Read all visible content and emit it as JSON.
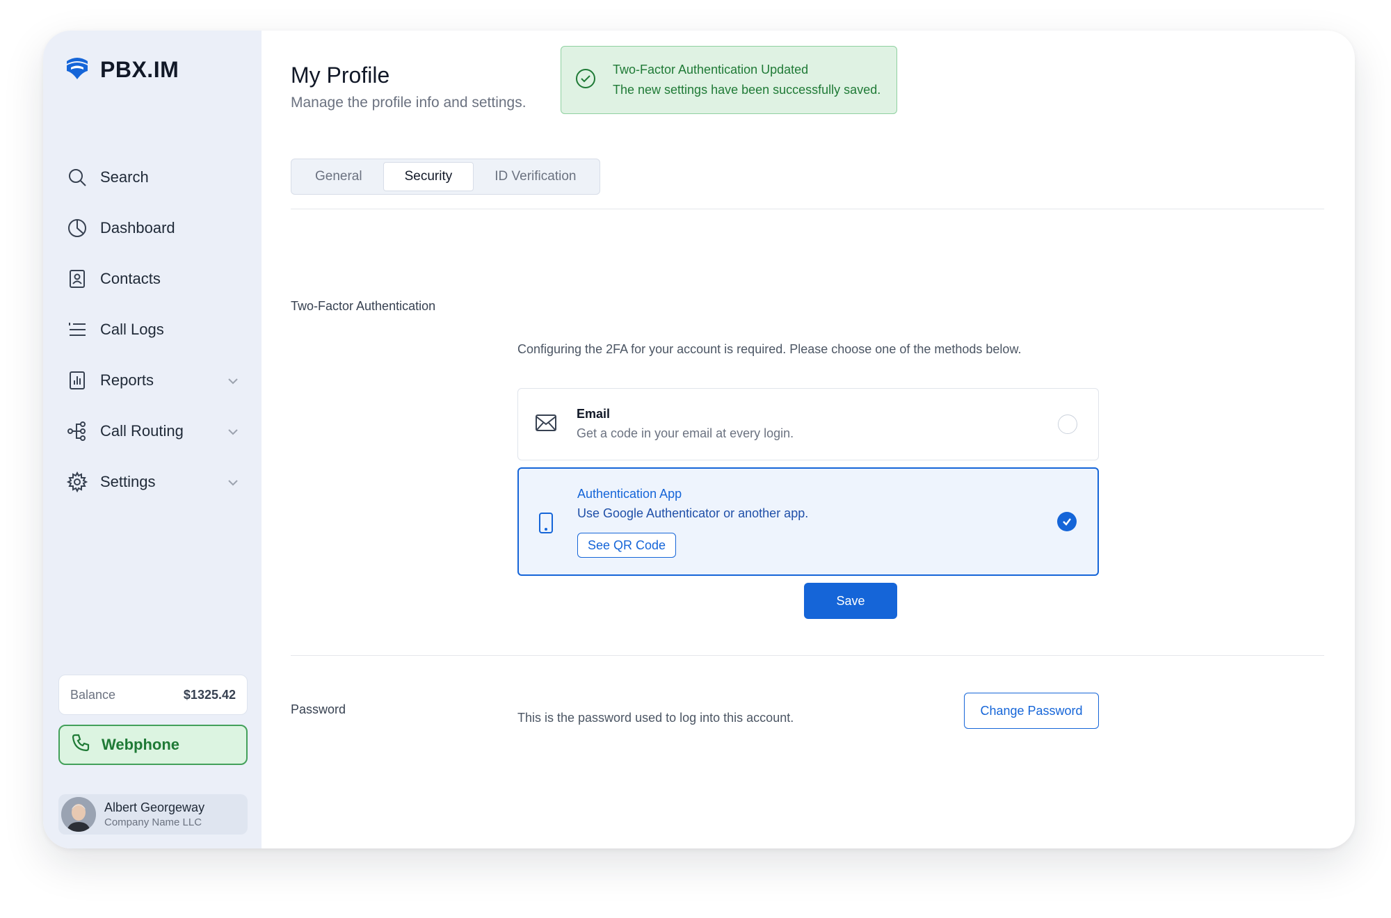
{
  "app": {
    "logo_text": "PBX.IM",
    "logo_icon": "pbx-logo-icon"
  },
  "sidebar": {
    "items": [
      {
        "label": "Search",
        "icon": "search-icon",
        "expandable": false
      },
      {
        "label": "Dashboard",
        "icon": "pie-chart-icon",
        "expandable": false
      },
      {
        "label": "Contacts",
        "icon": "contact-book-icon",
        "expandable": false
      },
      {
        "label": "Call Logs",
        "icon": "list-icon",
        "expandable": false
      },
      {
        "label": "Reports",
        "icon": "bar-chart-icon",
        "expandable": true
      },
      {
        "label": "Call Routing",
        "icon": "routing-icon",
        "expandable": true
      },
      {
        "label": "Settings",
        "icon": "gear-icon",
        "expandable": true
      }
    ],
    "balance": {
      "label": "Balance",
      "value": "$1325.42"
    },
    "webphone": {
      "label": "Webphone",
      "icon": "phone-icon"
    },
    "user": {
      "name": "Albert Georgeway",
      "company": "Company Name LLC"
    }
  },
  "header": {
    "title": "My Profile",
    "subtitle": "Manage the profile info and settings."
  },
  "toast": {
    "title": "Two-Factor Authentication Updated",
    "message": "The new settings have been successfully saved.",
    "icon": "check-circle-icon",
    "color": "#1f7a36"
  },
  "tabs": [
    {
      "label": "General",
      "active": false
    },
    {
      "label": "Security",
      "active": true
    },
    {
      "label": "ID Verification",
      "active": false
    }
  ],
  "two_factor": {
    "section_label": "Two-Factor Authentication",
    "description": "Configuring the 2FA for your account is required. Please choose one of the methods below.",
    "options": [
      {
        "title": "Email",
        "description": "Get a code in your email at every login.",
        "icon": "envelope-icon",
        "selected": false
      },
      {
        "title": "Authentication App",
        "description": "Use Google Authenticator or another app.",
        "icon": "smartphone-icon",
        "selected": true,
        "action_label": "See QR Code"
      }
    ],
    "save_label": "Save"
  },
  "password": {
    "section_label": "Password",
    "description": "This is the password used to log into this account.",
    "button_label": "Change Password"
  },
  "colors": {
    "accent": "#1565d8",
    "success": "#1f7a36",
    "sidebar_bg": "#ebeff8"
  }
}
